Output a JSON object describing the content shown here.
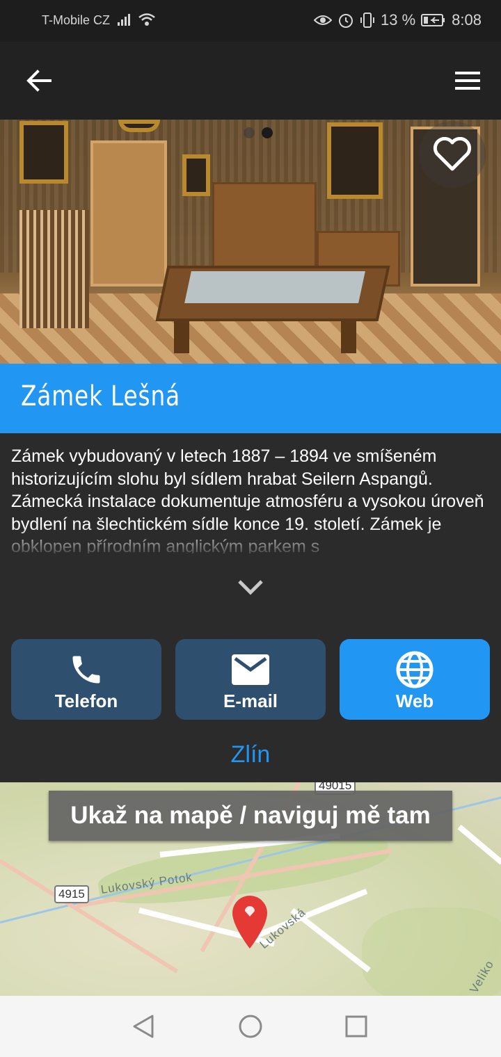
{
  "status_bar": {
    "carrier": "T-Mobile CZ",
    "battery_percent": "13 %",
    "time": "8:08"
  },
  "app_bar": {
    "back_icon": "arrow-left-icon",
    "menu_icon": "hamburger-menu-icon"
  },
  "hero": {
    "image_description": "photo",
    "carousel_total": 2,
    "carousel_active": 2,
    "favorite_icon": "heart-outline-icon"
  },
  "place": {
    "title": "Zámek Lešná",
    "description": "Zámek vybudovaný v letech 1887 – 1894 ve smíšeném historizujícím slohu byl sídlem hrabat Seilern Aspangů. Zámecká instalace dokumentuje atmosféru a vysokou úroveň bydlení na šlechtickém sídle konce 19. století. Zámek je obklopen přírodním anglickým parkem s",
    "expand_icon": "chevron-down-icon",
    "city": "Zlín"
  },
  "actions": [
    {
      "label": "Telefon",
      "icon": "phone-icon"
    },
    {
      "label": "E-mail",
      "icon": "mail-icon"
    },
    {
      "label": "Web",
      "icon": "globe-icon"
    }
  ],
  "map": {
    "button_label": "Ukaž na mapě / naviguj mě tam",
    "labels": {
      "area": "Lukovský Potok",
      "street": "Lukovská",
      "other": "Veliko"
    },
    "shields": {
      "road_4915": "4915",
      "road_49015": "49015"
    },
    "pin_icon": "map-pin-icon"
  },
  "colors": {
    "accent": "#2196f3",
    "action_button": "#2f4f6e",
    "background": "#2b2b2b",
    "app_bar": "#222222"
  }
}
